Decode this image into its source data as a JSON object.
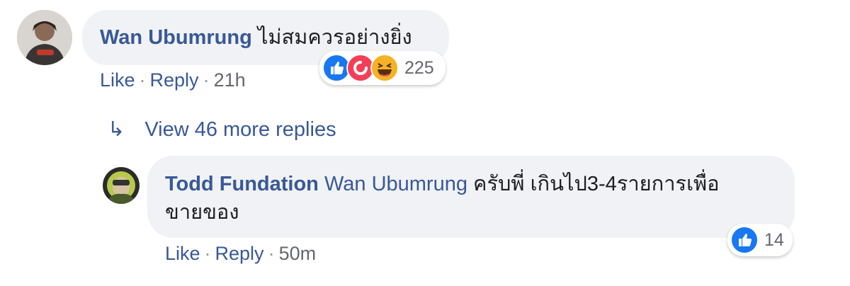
{
  "comment": {
    "author": "Wan Ubumrung",
    "text": "ไม่สมควรอย่างยิ่ง",
    "like_label": "Like",
    "reply_label": "Reply",
    "time": "21h",
    "separator": "·",
    "reaction_icons": [
      "like-icon",
      "care-icon",
      "haha-icon"
    ],
    "reaction_count": "225"
  },
  "view_more": {
    "arrow": "↳",
    "label": "View 46 more replies"
  },
  "reply": {
    "author": "Todd Fundation",
    "mention": "Wan Ubumrung",
    "text_line1": " ครับพี่ เกินไป3-4รายการเพื่อ",
    "text_line2": "ขายของ",
    "like_label": "Like",
    "reply_label": "Reply",
    "time": "50m",
    "separator": "·",
    "reaction_icons": [
      "like-icon"
    ],
    "reaction_count": "14"
  },
  "colors": {
    "link": "#385898",
    "bubble": "#f0f2f5",
    "like_blue": "#1877f2",
    "care_red": "#f33e58",
    "haha_yellow": "#f7b125"
  }
}
